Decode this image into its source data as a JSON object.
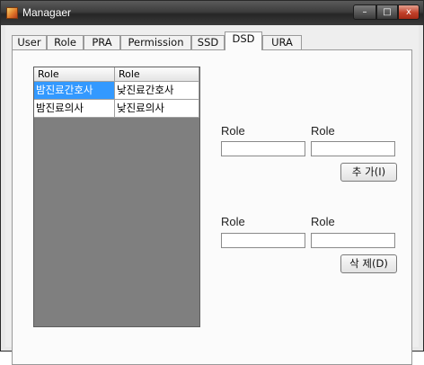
{
  "window": {
    "title": "Managaer",
    "controls": {
      "minimize": "–",
      "maximize": "□",
      "close": "x"
    }
  },
  "tabs": [
    {
      "label": "User"
    },
    {
      "label": "Role"
    },
    {
      "label": "PRA"
    },
    {
      "label": "Permission"
    },
    {
      "label": "SSD"
    },
    {
      "label": "DSD"
    },
    {
      "label": "URA"
    }
  ],
  "active_tab": "DSD",
  "grid": {
    "columns": [
      "Role",
      "Role"
    ],
    "rows": [
      [
        "밤진료간호사",
        "낮진료간호사"
      ],
      [
        "밤진료의사",
        "낮진료의사"
      ]
    ],
    "selected_cell": "row 1, column 1"
  },
  "add_form": {
    "label_1": "Role",
    "label_2": "Role",
    "value_1": "",
    "value_2": "",
    "button": "추  가(I)"
  },
  "delete_form": {
    "label_1": "Role",
    "label_2": "Role",
    "value_1": "",
    "value_2": "",
    "button": "삭  제(D)"
  }
}
